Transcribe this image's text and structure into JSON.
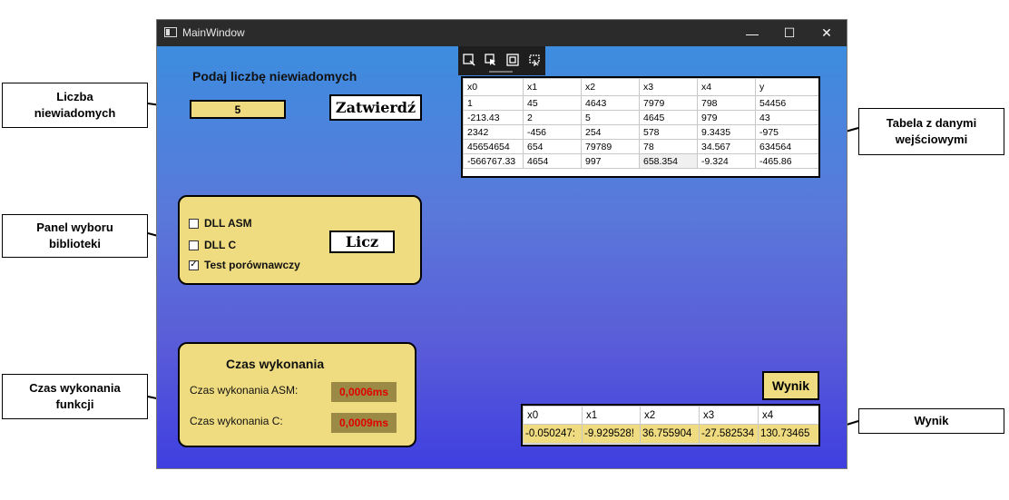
{
  "window": {
    "title": "MainWindow",
    "minimize": "—",
    "maximize": "☐",
    "close": "✕"
  },
  "unknowns": {
    "prompt": "Podaj liczbę niewiadomych",
    "value": "5",
    "confirm_button": "Zatwierdź"
  },
  "library_panel": {
    "options": [
      {
        "label": "DLL ASM",
        "checked": ""
      },
      {
        "label": "DLL C",
        "checked": ""
      },
      {
        "label": "Test porównawczy",
        "checked": "✓"
      }
    ],
    "compute_button": "Licz"
  },
  "timing_panel": {
    "title": "Czas wykonania",
    "asm_label": "Czas wykonania ASM:",
    "asm_value": "0,0006ms",
    "c_label": "Czas wykonania C:",
    "c_value": "0,0009ms"
  },
  "input_table": {
    "headers": [
      "x0",
      "x1",
      "x2",
      "x3",
      "x4",
      "y"
    ],
    "rows": [
      [
        "1",
        "45",
        "4643",
        "7979",
        "798",
        "54456"
      ],
      [
        "-213.43",
        "2",
        "5",
        "4645",
        "979",
        "43"
      ],
      [
        "2342",
        "-456",
        "254",
        "578",
        "9.3435",
        "-975"
      ],
      [
        "45654654",
        "654",
        "79789",
        "78",
        "34.567",
        "634564"
      ],
      [
        "-566767.33",
        "4654",
        "997",
        "658.354",
        "-9.324",
        "-465.86"
      ]
    ]
  },
  "result": {
    "label": "Wynik",
    "headers": [
      "x0",
      "x1",
      "x2",
      "x3",
      "x4"
    ],
    "values": [
      "-0.050247:",
      "-9.929528!",
      "36.755904",
      "-27.582534",
      "130.73465"
    ]
  },
  "annotations": {
    "unknowns_count": "Liczba\nniewiadomych",
    "library_panel": "Panel wyboru\nbiblioteki",
    "execution_time": "Czas wykonania\nfunkcji",
    "input_table": "Tabela z danymi\nwejściowymi",
    "result": "Wynik"
  },
  "colors": {
    "panel_yellow": "#f0dc80",
    "time_red": "#e00000",
    "time_bg": "#9b8a45",
    "gradient_top": "#3d8ddf",
    "gradient_bottom": "#3f3fe0"
  }
}
